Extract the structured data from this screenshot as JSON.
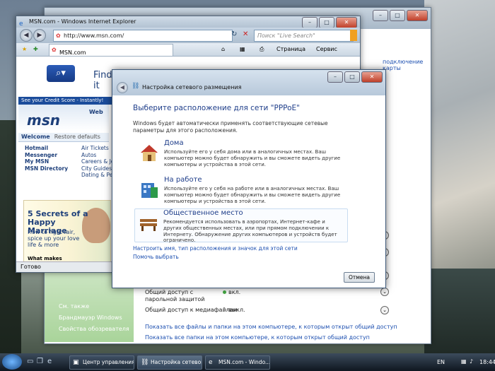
{
  "colors": {
    "link": "#1c4fb0",
    "heading": "#1f3e8a",
    "taskbar": "#1f2b38"
  },
  "ie": {
    "title": "MSN.com - Windows Internet Explorer",
    "address": "http://www.msn.com/",
    "search_placeholder": "Поиск \"Live Search\"",
    "tab_label": "MSN.com",
    "page_menu": "Страница",
    "tools_menu": "Сервис",
    "status": "Готово",
    "msn": {
      "find": "Find it",
      "credit": "See your Credit Score - Instantly!",
      "logo": "msn",
      "web_tab": "Web",
      "welcome": "Welcome",
      "restore": "Restore defaults",
      "links_left": [
        "Hotmail",
        "Messenger",
        "My MSN",
        "MSN Directory"
      ],
      "links_right": [
        "Air Tickets",
        "Autos",
        "Careers & Jo",
        "City Guides",
        "Dating & Per"
      ],
      "ad_title": "5 Secrets of a Happy Marriage",
      "ad_sub": "How to fight fair, spice up your love life & more",
      "ad_q": "What makes love last?"
    }
  },
  "dialog": {
    "title": "Настройка сетевого размещения",
    "heading": "Выберите расположение для сети \"PPPoE\"",
    "description": "Windows будет автоматически применять соответствующие сетевые параметры для этого расположения.",
    "options": [
      {
        "name": "Дома",
        "text": "Используйте его у себя дома или в аналогичных местах. Ваш компьютер можно будет обнаружить и вы сможете видеть другие компьютеры и устройства в этой сети."
      },
      {
        "name": "На работе",
        "text": "Используйте его у себя на работе или в аналогичных местах. Ваш компьютер можно будет обнаружить и вы сможете видеть другие компьютеры и устройства в этой сети."
      },
      {
        "name": "Общественное место",
        "text": "Рекомендуется использовать в аэропортах, Интернет-кафе и других общественных местах, или при прямом подключении к Интернету. Обнаружение других компьютеров и устройств будет ограничено."
      }
    ],
    "link_customize": "Настроить имя, тип расположения и значок для этой сети",
    "link_help": "Помочь выбрать",
    "cancel": "Отмена"
  },
  "control_panel": {
    "side_header": "См. также",
    "side_links": [
      "Брандмауэр Windows",
      "Свойства обозревателя"
    ],
    "right_links": [
      "подключение карты",
      "о",
      "о",
      "о",
      "о"
    ],
    "rows": [
      {
        "label": "Общий доступ с парольной защитой",
        "value": "вкл.",
        "on": true
      },
      {
        "label": "Общий доступ к медиафайлам",
        "value": "выкл.",
        "on": false
      }
    ],
    "bottom_links": [
      "Показать все файлы и папки на этом компьютере, к которым открыт общий доступ",
      "Показать все папки на этом компьютере, к которым открыт общий доступ"
    ]
  },
  "taskbar": {
    "buttons": [
      "Центр управления ...",
      "Настройка сетевог...",
      "MSN.com - Windo..."
    ],
    "lang": "EN",
    "clock": "18:44"
  }
}
